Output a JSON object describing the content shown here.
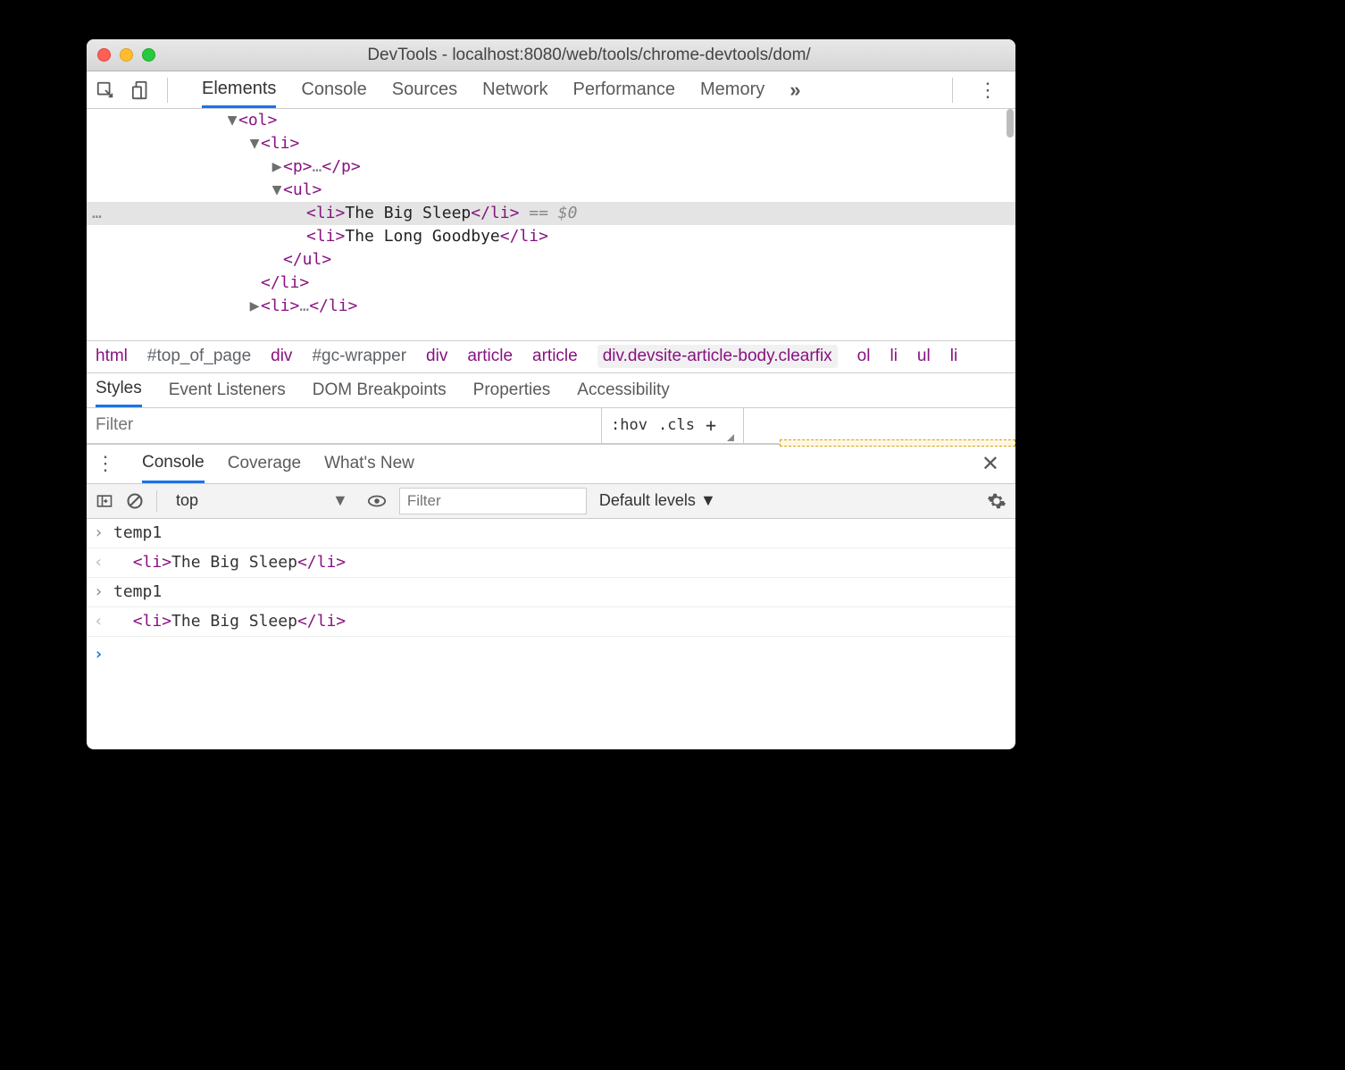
{
  "window_title": "DevTools - localhost:8080/web/tools/chrome-devtools/dom/",
  "main_tabs": {
    "items": [
      "Elements",
      "Console",
      "Sources",
      "Network",
      "Performance",
      "Memory"
    ],
    "active_index": 0
  },
  "dom_tree": {
    "rows": [
      {
        "indent": 156,
        "tri": "down",
        "open": "<ol>"
      },
      {
        "indent": 181,
        "tri": "down",
        "open": "<li>"
      },
      {
        "indent": 206,
        "tri": "right",
        "open": "<p>",
        "ellipsis": "…",
        "close": "</p>"
      },
      {
        "indent": 206,
        "tri": "down",
        "open": "<ul>"
      },
      {
        "indent": 246,
        "open": "<li>",
        "text": "The Big Sleep",
        "close": "</li>",
        "selected": true,
        "eq0": " == $0"
      },
      {
        "indent": 246,
        "open": "<li>",
        "text": "The Long Goodbye",
        "close": "</li>"
      },
      {
        "indent": 220,
        "close": "</ul>"
      },
      {
        "indent": 195,
        "close": "</li>"
      },
      {
        "indent": 181,
        "tri": "right",
        "open": "<li>",
        "ellipsis": "…",
        "close": "</li>"
      }
    ],
    "ellipsis_marker": "…"
  },
  "breadcrumb": {
    "items": [
      {
        "label": "html"
      },
      {
        "label": "#top_of_page",
        "dim": true
      },
      {
        "label": "div"
      },
      {
        "label": "#gc-wrapper",
        "dim": true
      },
      {
        "label": "div"
      },
      {
        "label": "article"
      },
      {
        "label": "article"
      },
      {
        "label": "div.devsite-article-body.clearfix",
        "sel": true
      },
      {
        "label": "ol"
      },
      {
        "label": "li"
      },
      {
        "label": "ul"
      },
      {
        "label": "li"
      }
    ]
  },
  "styles_tabs": {
    "items": [
      "Styles",
      "Event Listeners",
      "DOM Breakpoints",
      "Properties",
      "Accessibility"
    ],
    "active_index": 0
  },
  "filter_row": {
    "placeholder": "Filter",
    "hov": ":hov",
    "cls": ".cls"
  },
  "console_tabs": {
    "items": [
      "Console",
      "Coverage",
      "What's New"
    ],
    "active_index": 0
  },
  "console_toolbar": {
    "context": "top",
    "filter_placeholder": "Filter",
    "levels": "Default levels"
  },
  "console_body": {
    "entries": [
      {
        "kind": "input",
        "text": "temp1"
      },
      {
        "kind": "output",
        "open": "<li>",
        "text": "The Big Sleep",
        "close": "</li>"
      },
      {
        "kind": "input",
        "text": "temp1"
      },
      {
        "kind": "output",
        "open": "<li>",
        "text": "The Big Sleep",
        "close": "</li>"
      }
    ]
  }
}
